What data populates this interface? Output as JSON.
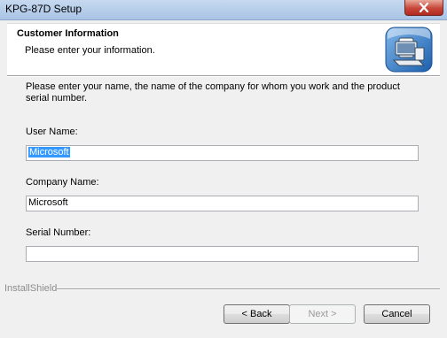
{
  "window": {
    "title": "KPG-87D Setup"
  },
  "header": {
    "title": "Customer Information",
    "subtitle": "Please enter your information."
  },
  "body": {
    "instructions": "Please enter your name, the name of the company for whom you work and the product serial number."
  },
  "fields": {
    "user_name": {
      "label": "User Name:",
      "value": "Microsoft"
    },
    "company_name": {
      "label": "Company Name:",
      "value": "Microsoft"
    },
    "serial_number": {
      "label": "Serial Number:",
      "value": ""
    }
  },
  "footer": {
    "brand": "InstallShield"
  },
  "buttons": {
    "back": "< Back",
    "next": "Next >",
    "cancel": "Cancel"
  },
  "colors": {
    "selection": "#3399ff",
    "close": "#c7463a"
  },
  "icons": [
    "close-icon",
    "computer-setup-icon"
  ]
}
